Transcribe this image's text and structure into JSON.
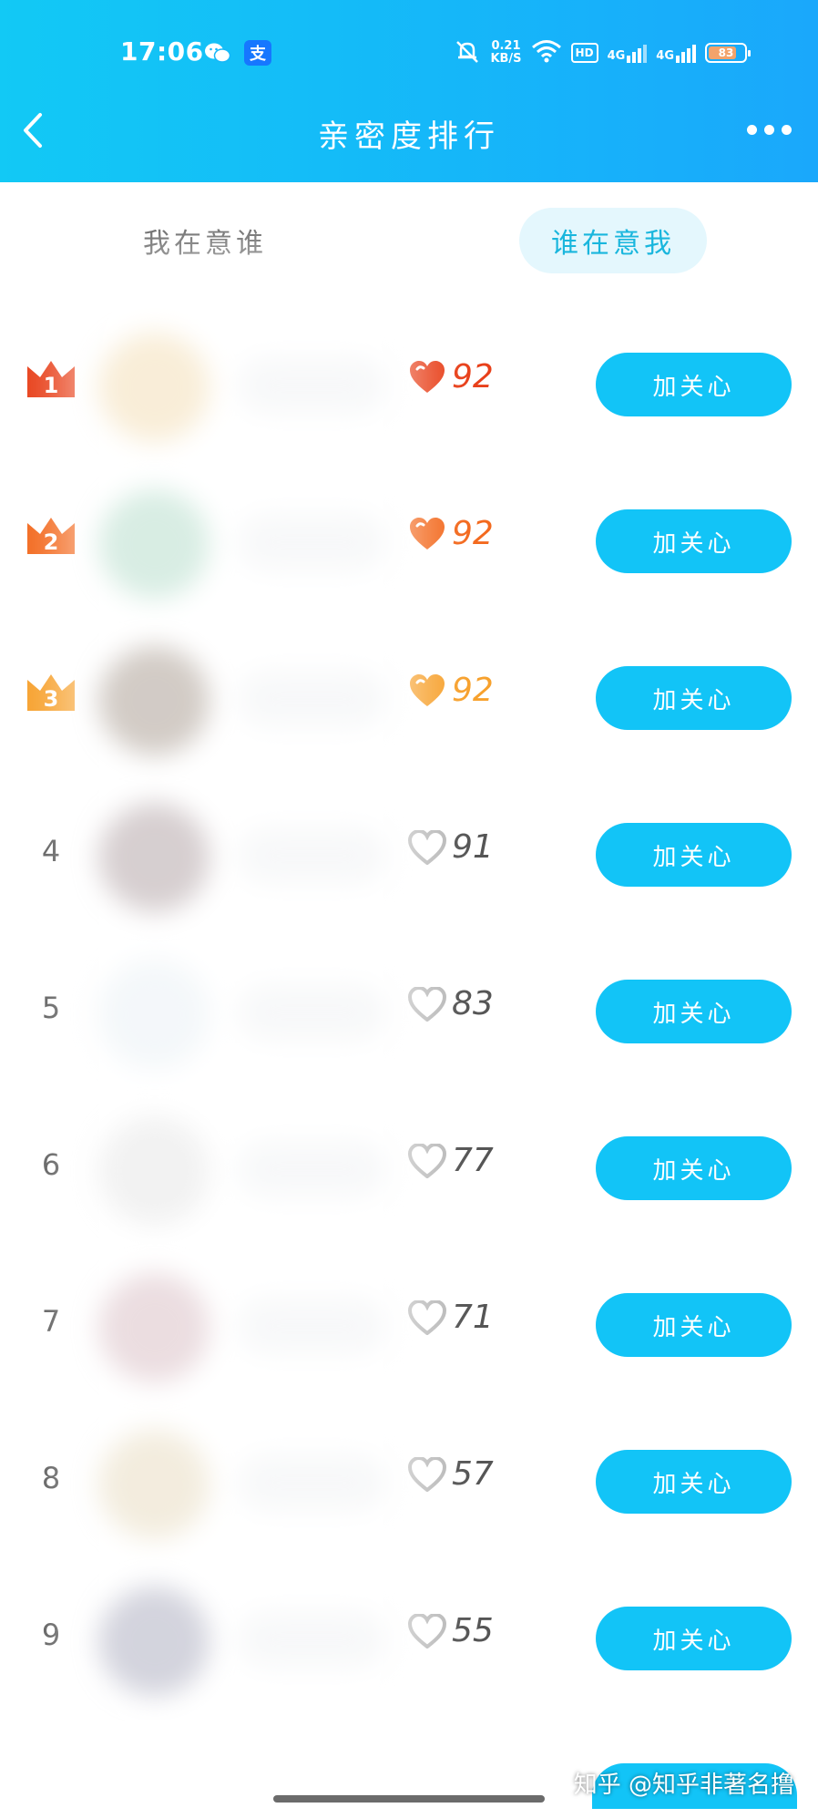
{
  "status": {
    "time": "17:06",
    "net_speed_value": "0.21",
    "net_speed_unit": "KB/S",
    "hd": "HD",
    "sig1": "4G",
    "sig2": "4G",
    "battery": "83",
    "alipay_glyph": "支"
  },
  "nav": {
    "title": "亲密度排行"
  },
  "tabs": [
    {
      "label": "我在意谁",
      "selected": false
    },
    {
      "label": "谁在意我",
      "selected": true
    }
  ],
  "colors": {
    "accent": "#12c4f7",
    "rank1": "#e8401a",
    "rank2": "#f36a1f",
    "rank3": "#f7a12d",
    "gray": "#b8b8b8"
  },
  "rows": [
    {
      "rank": "1",
      "score": "92",
      "button": "加关心",
      "avatar_color": "#f1d8a8"
    },
    {
      "rank": "2",
      "score": "92",
      "button": "加关心",
      "avatar_color": "#a9d7c2"
    },
    {
      "rank": "3",
      "score": "92",
      "button": "加关心",
      "avatar_color": "#9c8d80"
    },
    {
      "rank": "4",
      "score": "91",
      "button": "加关心",
      "avatar_color": "#a59497"
    },
    {
      "rank": "5",
      "score": "83",
      "button": "加关心",
      "avatar_color": "#e6eef3"
    },
    {
      "rank": "6",
      "score": "77",
      "button": "加关心",
      "avatar_color": "#e2e2e2"
    },
    {
      "rank": "7",
      "score": "71",
      "button": "加关心",
      "avatar_color": "#d3b4bb"
    },
    {
      "rank": "8",
      "score": "57",
      "button": "加关心",
      "avatar_color": "#e4d6b6"
    },
    {
      "rank": "9",
      "score": "55",
      "button": "加关心",
      "avatar_color": "#9e9fb4"
    }
  ],
  "watermark": "知乎 @知乎非著名撸"
}
